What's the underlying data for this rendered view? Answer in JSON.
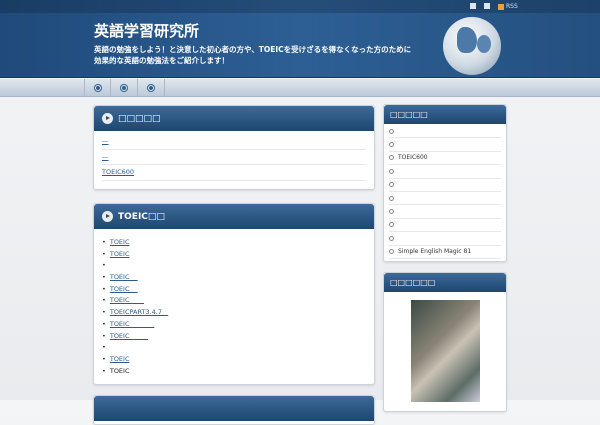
{
  "topbar": {
    "links": [
      {
        "icon": "bookmark-icon"
      },
      {
        "icon": "mail-icon"
      },
      {
        "icon": "rss-icon",
        "label": "RSS"
      }
    ]
  },
  "header": {
    "title": "英語学習研究所",
    "description_line1": "英語の勉強をしよう！と決意した初心者の方や、TOEICを受けざるを得なくなった方のために",
    "description_line2": "効果的な英語の勉強法をご紹介します！"
  },
  "nav": {
    "items": [
      {
        "icon": "nav-dot-icon"
      },
      {
        "icon": "nav-dot-icon"
      },
      {
        "icon": "nav-dot-icon"
      }
    ]
  },
  "main": {
    "box1": {
      "title": "□□□□□",
      "links": [
        "—",
        "—",
        "TOEIC600"
      ]
    },
    "box2": {
      "title": "TOEIC□□",
      "items": [
        {
          "text": "TOEIC",
          "link": true
        },
        {
          "text": "TOEIC",
          "link": true
        },
        {
          "text": " ",
          "link": true
        },
        {
          "text": "TOEIC    ",
          "link": true
        },
        {
          "text": "TOEIC    ",
          "link": true
        },
        {
          "text": "TOEIC       ",
          "link": true
        },
        {
          "text": "TOEICPART3.4.7   ",
          "link": true
        },
        {
          "text": "TOEIC            ",
          "link": true
        },
        {
          "text": "TOEIC         ",
          "link": true
        },
        {
          "text": " ",
          "link": true
        },
        {
          "text": "TOEIC",
          "link": true
        },
        {
          "text": "TOEIC",
          "link": false
        }
      ]
    }
  },
  "sidebar": {
    "box1": {
      "title": "□□□□□",
      "items": [
        "",
        "",
        "TOEIC600",
        "",
        "",
        "",
        "",
        "",
        "",
        "Simple English Magic 81"
      ]
    },
    "box2": {
      "title": "□□□□□□"
    }
  }
}
